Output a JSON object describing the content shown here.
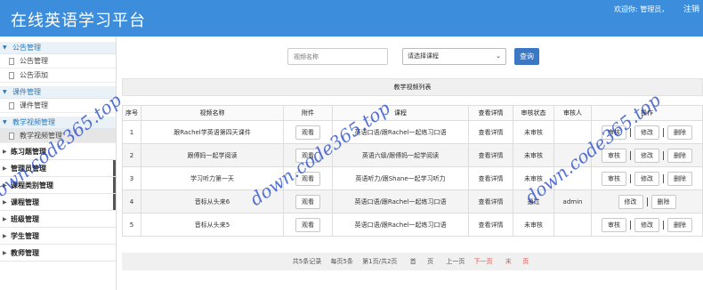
{
  "header": {
    "logo": "在线英语学习平台",
    "welcome": "欢迎你: 管理员，",
    "logout": "注销"
  },
  "sidebar": {
    "sections": [
      {
        "title": "公告管理",
        "items": [
          "公告管理",
          "公告添加"
        ]
      },
      {
        "title": "课件管理",
        "items": [
          "课件管理"
        ]
      },
      {
        "title": "教学视频管理",
        "items": [
          "教学视频管理"
        ]
      }
    ],
    "main_items": [
      "练习题管理",
      "管理员管理",
      "课程类别管理",
      "课程管理",
      "班级管理",
      "学生管理",
      "教师管理"
    ]
  },
  "search": {
    "placeholder": "视频名称",
    "course_select": "请选择课程",
    "query_button": "查询"
  },
  "table": {
    "title": "教学视频列表",
    "columns": [
      "序号",
      "视频名称",
      "附件",
      "课程",
      "查看详情",
      "审核状态",
      "审核人",
      "操作"
    ],
    "rows": [
      {
        "no": "1",
        "name": "跟Rachel学英语第四天课件",
        "attach": "观看",
        "course": "英语口语/跟Rachel一起练习口语",
        "detail": "查看详情",
        "status": "未审核",
        "reviewer": "",
        "audit": "审核",
        "edit": "修改",
        "del": "删除"
      },
      {
        "no": "2",
        "name": "跟傅妈一起学阅读",
        "attach": "观看",
        "course": "英语六级/跟傅妈一起学阅读",
        "detail": "查看详情",
        "status": "未审核",
        "reviewer": "",
        "audit": "审核",
        "edit": "修改",
        "del": "删除"
      },
      {
        "no": "3",
        "name": "学习听力第一天",
        "attach": "观看",
        "course": "英语听力/跟Shane一起学习听力",
        "detail": "查看详情",
        "status": "未审核",
        "reviewer": "",
        "audit": "审核",
        "edit": "修改",
        "del": "删除"
      },
      {
        "no": "4",
        "name": "音标从头来6",
        "attach": "观看",
        "course": "英语口语/跟Rachel一起练习口语",
        "detail": "查看详情",
        "status": "通过",
        "reviewer": "admin",
        "audit": "",
        "edit": "修改",
        "del": "删除"
      },
      {
        "no": "5",
        "name": "音标从头来5",
        "attach": "观看",
        "course": "英语口语/跟Rachel一起练习口语",
        "detail": "查看详情",
        "status": "未审核",
        "reviewer": "",
        "audit": "审核",
        "edit": "修改",
        "del": "删除"
      }
    ]
  },
  "pager": {
    "total": "共5条记录",
    "per_page": "每页5条",
    "page_info": "第1页/共2页",
    "first": "首",
    "first2": "页",
    "prev": "上一页",
    "next": "下一页",
    "last": "末",
    "last2": "页"
  },
  "watermark": "down.code365.top",
  "colors": {
    "header": "#3c8ddb",
    "button": "#3a78c3",
    "link_red": "#d9534f",
    "watermark": "#143cc8"
  }
}
